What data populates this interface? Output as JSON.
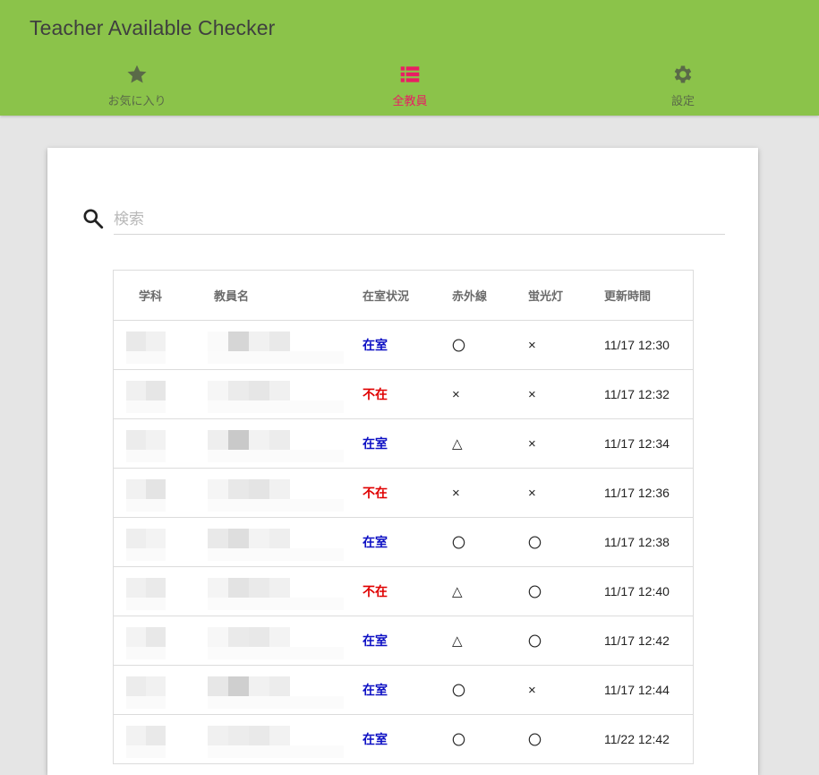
{
  "app": {
    "title": "Teacher Available Checker"
  },
  "nav": {
    "tabs": [
      {
        "label": "お気に入り",
        "icon": "star-icon",
        "active": false
      },
      {
        "label": "全教員",
        "icon": "list-icon",
        "active": true
      },
      {
        "label": "設定",
        "icon": "gear-icon",
        "active": false
      }
    ],
    "active_color": "#e91e63",
    "bar_color": "#8bc34a"
  },
  "search": {
    "placeholder": "検索",
    "value": ""
  },
  "table": {
    "headers": {
      "dept": "学科",
      "name": "教員名",
      "status": "在室状況",
      "infrared": "赤外線",
      "light": "蛍光灯",
      "updated": "更新時間"
    },
    "rows": [
      {
        "status": "在室",
        "infrared": "〇",
        "light": "×",
        "updated": "11/17 12:30"
      },
      {
        "status": "不在",
        "infrared": "×",
        "light": "×",
        "updated": "11/17 12:32"
      },
      {
        "status": "在室",
        "infrared": "△",
        "light": "×",
        "updated": "11/17 12:34"
      },
      {
        "status": "不在",
        "infrared": "×",
        "light": "×",
        "updated": "11/17 12:36"
      },
      {
        "status": "在室",
        "infrared": "〇",
        "light": "〇",
        "updated": "11/17 12:38"
      },
      {
        "status": "不在",
        "infrared": "△",
        "light": "〇",
        "updated": "11/17 12:40"
      },
      {
        "status": "在室",
        "infrared": "△",
        "light": "〇",
        "updated": "11/17 12:42"
      },
      {
        "status": "在室",
        "infrared": "〇",
        "light": "×",
        "updated": "11/17 12:44"
      },
      {
        "status": "在室",
        "infrared": "〇",
        "light": "〇",
        "updated": "11/22 12:42"
      }
    ],
    "status_colors": {
      "在室": "#0d10c4",
      "不在": "#e00000"
    }
  }
}
